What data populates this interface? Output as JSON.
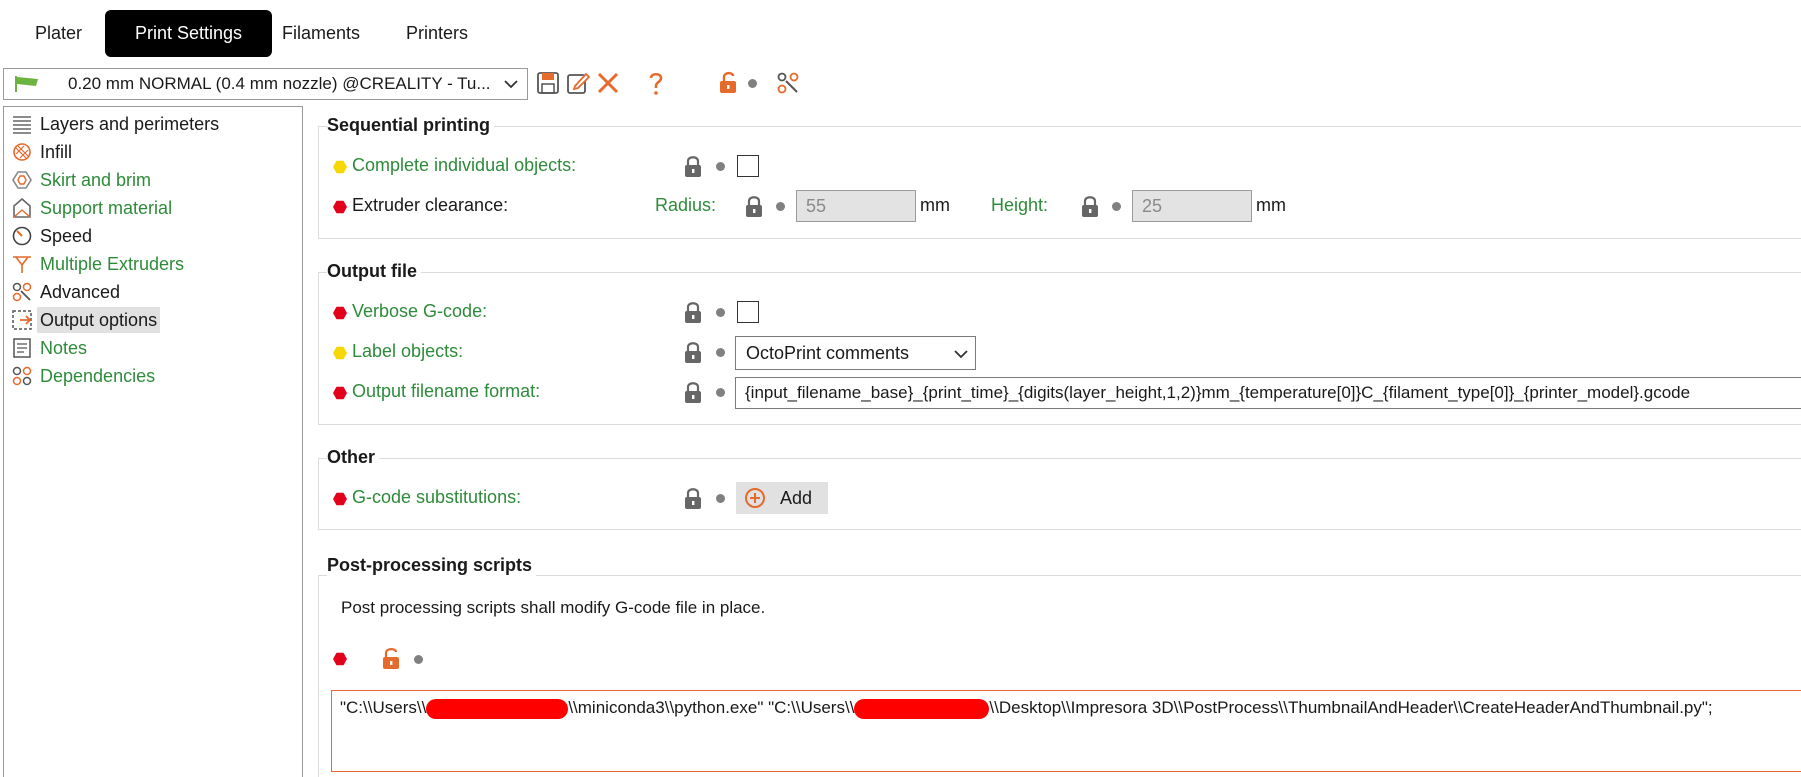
{
  "tabs": [
    {
      "label": "Plater"
    },
    {
      "label": "Print Settings"
    },
    {
      "label": "Filaments"
    },
    {
      "label": "Printers"
    }
  ],
  "preset": {
    "label": "0.20 mm NORMAL (0.4 mm nozzle) @CREALITY - Tu...",
    "flag_color": "#6db33f"
  },
  "sidebar": {
    "items": [
      {
        "label": "Layers and perimeters"
      },
      {
        "label": "Infill"
      },
      {
        "label": "Skirt and brim"
      },
      {
        "label": "Support material"
      },
      {
        "label": "Speed"
      },
      {
        "label": "Multiple Extruders"
      },
      {
        "label": "Advanced"
      },
      {
        "label": "Output options"
      },
      {
        "label": "Notes"
      },
      {
        "label": "Dependencies"
      }
    ]
  },
  "sequential": {
    "title": "Sequential printing",
    "complete_label": "Complete individual objects:",
    "complete_checked": false,
    "clearance_label": "Extruder clearance:",
    "radius_label": "Radius:",
    "radius_value": "55",
    "radius_unit": "mm",
    "height_label": "Height:",
    "height_value": "25",
    "height_unit": "mm"
  },
  "output": {
    "title": "Output file",
    "verbose_label": "Verbose G-code:",
    "verbose_checked": false,
    "label_objects_label": "Label objects:",
    "label_objects_value": "OctoPrint comments",
    "filename_label": "Output filename format:",
    "filename_value": "{input_filename_base}_{print_time}_{digits(layer_height,1,2)}mm_{temperature[0]}C_{filament_type[0]}_{printer_model}.gcode"
  },
  "other": {
    "title": "Other",
    "gcode_sub_label": "G-code substitutions:",
    "add_label": "Add"
  },
  "post": {
    "title": "Post-processing scripts",
    "description": "Post processing scripts shall modify G-code file in place.",
    "script_part1": "\"C:\\\\Users\\\\",
    "script_part2": "\\\\miniconda3\\\\python.exe\" \"C:\\\\Users\\\\",
    "script_part3": "\\\\Desktop\\\\Impresora 3D\\\\PostProcess\\\\ThumbnailAndHeader\\\\CreateHeaderAndThumbnail.py\";"
  },
  "colors": {
    "accent_orange": "#e66a2c",
    "label_green": "#2e8b3a",
    "required_red": "#e3001b",
    "simple_yellow": "#f5d800"
  }
}
